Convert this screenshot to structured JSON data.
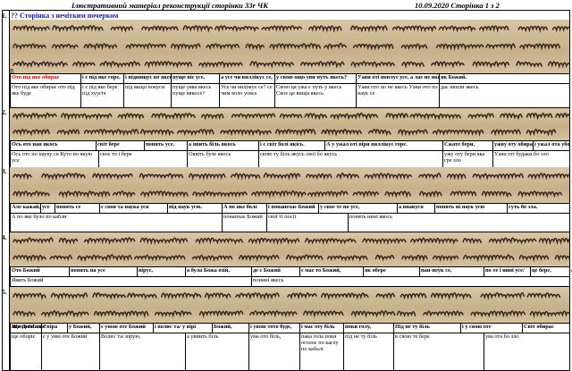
{
  "header": {
    "title": "Ілюстративний матеріал  реконструкції сторінки 33r ЧК",
    "date_page": "10.09.2020  Сторінка 1 з 2"
  },
  "subtitle": "?? Сторінка з нечітким почерком",
  "corner_letter": "R",
  "rows": [
    {
      "num": "1.",
      "gloss": [
        {
          "t": "Ото під яке обирає",
          "red": true
        },
        {
          "t": "і є під яке горе,"
        },
        {
          "t": "і підвищує по якесь путь"
        },
        {
          "t": "пуще віє усе,"
        },
        {
          "t": "а усе чи виллікує се,"
        },
        {
          "t": "у свою ощо уви путь якесь?"
        },
        {
          "t": "Уави оті поплує усе, а лає не якесь,"
        },
        {
          "t": "як Божий."
        }
      ],
      "alt": [
        {
          "t": "Ото під яке обирає ото під яке буде"
        },
        {
          "t": "і є під яке бере під хуугіч"
        },
        {
          "t": "під якщо покуси"
        },
        {
          "t": "пуще уява якесь пуще вякосе?"
        },
        {
          "t": "Усе чи виліжує се? се чим воло уовсе"
        },
        {
          "t": "Свою ця ужа є путь у якесь Свое це вищи якесь"
        },
        {
          "t": "Уави ото по не якесь Уави ото по наук се"
        },
        {
          "t": "дає ивили якесь"
        }
      ]
    },
    {
      "num": "2.",
      "gloss": [
        {
          "t": "Ось ото нан якось"
        },
        {
          "t": "світ бере"
        },
        {
          "t": "понять усе,"
        },
        {
          "t": "а явить біль якось"
        },
        {
          "t": "і є світ болі якісь."
        },
        {
          "t": "А у ужал оті віри виллікує горе."
        },
        {
          "t": "Сжате бери,"
        },
        {
          "t": "ужву оту обирає,"
        },
        {
          "t": "і ужал ота уборе кебу злу."
        }
      ],
      "alt": [
        {
          "t": "Ось ото но науку ся Куто по якую усе"
        },
        {
          "t": "своє то і бере"
        },
        {
          "t": "Оявіть буле якось"
        },
        {
          "t": "свою ту біль якусь свої бо якусь"
        },
        {
          "t": "ужу оту бери яка гре зло"
        },
        {
          "t": "Уави оті будаки бо зло"
        }
      ]
    },
    {
      "num": "3.",
      "gloss": [
        {
          "t": "Але кажай,"
        },
        {
          "t": "усе"
        },
        {
          "t": "понять се"
        },
        {
          "t": "є своя та наука уся"
        },
        {
          "t": "під наук усю."
        },
        {
          "t": "А по яке болє"
        },
        {
          "t": "і понапехає Божий"
        },
        {
          "t": "у свое те по усе,"
        },
        {
          "t": "а внакуся"
        },
        {
          "t": "понять ні наук усю"
        },
        {
          "t": "суть бо зла."
        }
      ],
      "alt": [
        {
          "t": "А по яке було по кабли"
        },
        {
          "t": "понапхає Божий"
        },
        {
          "t": "свої ті посії"
        },
        {
          "t": "понять нині якось"
        }
      ]
    },
    {
      "num": "4.",
      "gloss": [
        {
          "t": "Ото Божий"
        },
        {
          "t": "понять на усе"
        },
        {
          "t": "вірує,"
        },
        {
          "t": "а була Божа озій,"
        },
        {
          "t": "де є Божий"
        },
        {
          "t": "є має то Божий,"
        },
        {
          "t": "як обере"
        },
        {
          "t": "пан-неук се,"
        },
        {
          "t": "по те і нині усе/"
        },
        {
          "t": "це бере,"
        },
        {
          "t": "а Божий дає."
        }
      ],
      "alt": [
        {
          "t": "Явить Божий"
        },
        {
          "t": "понині якесь"
        }
      ]
    },
    {
      "num": "5.",
      "gloss": [
        {
          "t": "Що ДжеБоже"
        },
        {
          "t": "є віра"
        },
        {
          "t": "у Божий,"
        },
        {
          "t": "є увою оте Божий"
        },
        {
          "t": "і волю/ та/ у вірі"
        },
        {
          "t": "Божий,"
        },
        {
          "t": "і увою тото буде,"
        },
        {
          "t": "і має оту біль"
        },
        {
          "t": "поки голу,"
        },
        {
          "t": "Під не ту біль"
        },
        {
          "t": "і у свою оте"
        },
        {
          "t": "Світ обирає"
        },
        {
          "t": "явити бо зло?"
        }
      ],
      "alt": [
        {
          "t": "ще оборіє"
        },
        {
          "t": "є у увві оте Божий"
        },
        {
          "t": "Волю/ та/ вірую,"
        },
        {
          "t": "а увиить біль"
        },
        {
          "t": "ума ото біль,"
        },
        {
          "t": "пака гола поки оголоє по каглу по кабалі"
        },
        {
          "t": "під не ту біль"
        },
        {
          "t": "в свою те бере"
        },
        {
          "t": "ува ота бо зло"
        }
      ]
    }
  ]
}
